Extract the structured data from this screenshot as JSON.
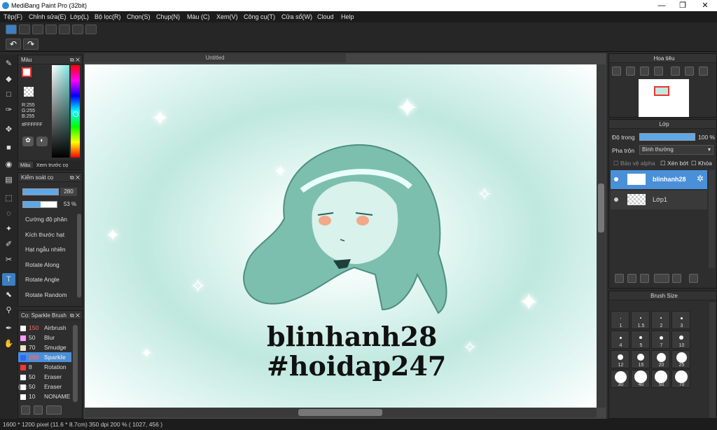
{
  "window": {
    "title": "MediBang Paint Pro (32bit)",
    "min": "—",
    "max": "❐",
    "close": "✕"
  },
  "menu": [
    "Tệp(F)",
    "Chỉnh sửa(E)",
    "Lớp(L)",
    "Bộ lọc(R)",
    "Chọn(S)",
    "Chụp(N)",
    "Màu (C)",
    "Xem(V)",
    "Công cụ(T)",
    "Cửa sổ(W)",
    "Cloud",
    "Help"
  ],
  "canvas_tab": "Untitled",
  "color_panel": {
    "title": "Màu",
    "r": "R:255",
    "g": "G:255",
    "b": "B:255",
    "hex": "#FFFFFF",
    "tab1": "Màu",
    "tab2": "Xem trước cọ"
  },
  "brush_control": {
    "title": "Kiểm soát cọ",
    "size": "280",
    "opacity": "53 %",
    "opacity_fraction": 0.53,
    "items": [
      "Cường độ phân",
      "Kích thước hạt",
      "Hạt ngẫu nhiên",
      "Rotate Along",
      "Rotate Angle",
      "Rotate Random"
    ]
  },
  "brush_list": {
    "title": "Cọ: Sparkle Brush",
    "items": [
      {
        "size": "150",
        "name": "Airbrush",
        "color": "#ffffff",
        "size_color": "#ff6666"
      },
      {
        "size": "50",
        "name": "Blur",
        "color": "#ff99ff",
        "size_color": "#dddddd"
      },
      {
        "size": "70",
        "name": "Smudge",
        "color": "#f4e3c7",
        "size_color": "#dddddd"
      },
      {
        "size": "280",
        "name": "Sparkle",
        "color": "#3366ff",
        "size_color": "#ff6666"
      },
      {
        "size": "8",
        "name": "Rotation",
        "color": "#ff3333",
        "size_color": "#dddddd"
      },
      {
        "size": "50",
        "name": "Eraser (Sc",
        "color": "#ffffff",
        "size_color": "#dddddd"
      },
      {
        "size": "50",
        "name": "Eraser",
        "color": "#ffffff",
        "size_color": "#dddddd"
      },
      {
        "size": "10",
        "name": "NONAME",
        "color": "#ffffff",
        "size_color": "#dddddd"
      }
    ]
  },
  "navigator": {
    "title": "Hoa tiêu"
  },
  "layer_panel": {
    "title": "Lớp",
    "opacity_label": "Độ trong",
    "opacity_value": "100 %",
    "blend_label": "Pha trộn",
    "blend_value": "Bình thường",
    "protect_alpha": "Bảo vệ alpha",
    "clipping": "Xén bớt",
    "lock": "Khóa",
    "layers": [
      "blinhanh28",
      "Lớp1"
    ]
  },
  "brush_size_panel": {
    "title": "Brush Size",
    "sizes": [
      "1",
      "1.5",
      "2",
      "3",
      "4",
      "5",
      "7",
      "10",
      "12",
      "15",
      "20",
      "25",
      "30",
      "40",
      "50",
      "70"
    ]
  },
  "canvas_text": {
    "line1": "blinhanh28",
    "line2": "#hoidap247"
  },
  "status": "1600 * 1200 pixel  (11.6 * 8.7cm)  350 dpi  200 %  ( 1027, 456 )"
}
